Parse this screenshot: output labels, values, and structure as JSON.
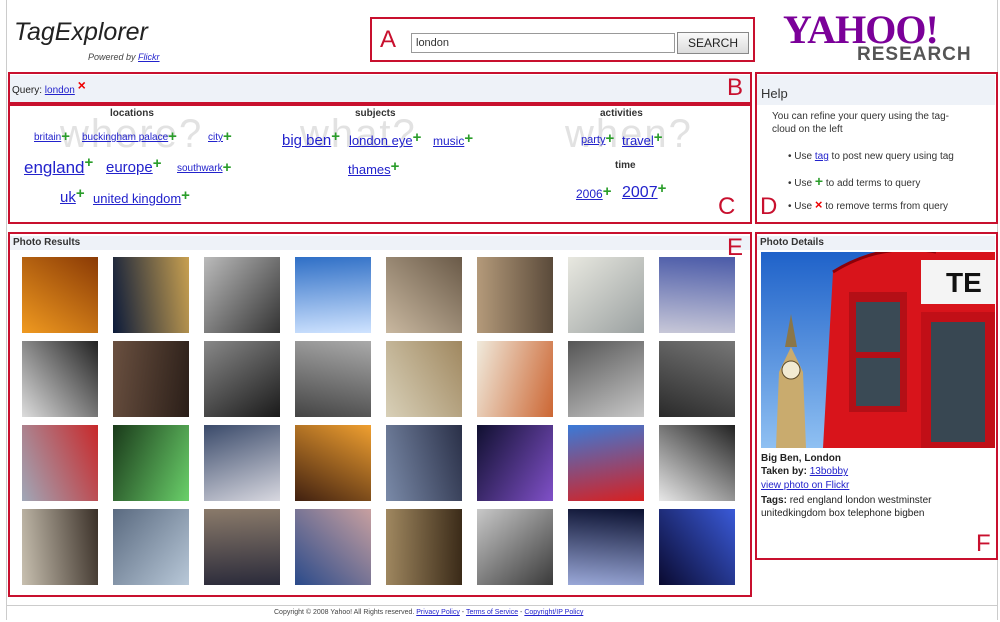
{
  "header": {
    "app_title": "TagExplorer",
    "powered_by": "Powered by",
    "powered_link": "Flickr",
    "logo_top": "YAHOO!",
    "logo_bottom": "RESEARCH"
  },
  "search": {
    "value": "london",
    "button_label": "SEARCH"
  },
  "query": {
    "label": "Query:",
    "term": "london",
    "remove_glyph": "×"
  },
  "box_labels": {
    "a": "A",
    "b": "B",
    "c": "C",
    "d": "D",
    "e": "E",
    "f": "F"
  },
  "tagcloud": {
    "ghost_words": [
      "where?",
      "what?",
      "when?"
    ],
    "locations": {
      "heading": "locations",
      "tags": [
        "britain",
        "buckingham palace",
        "city",
        "england",
        "europe",
        "southwark",
        "uk",
        "united kingdom"
      ]
    },
    "subjects": {
      "heading": "subjects",
      "tags": [
        "big ben",
        "london eye",
        "music",
        "thames"
      ]
    },
    "activities": {
      "heading": "activities",
      "tags": [
        "party",
        "travel"
      ]
    },
    "time": {
      "heading": "time",
      "tags": [
        "2006",
        "2007"
      ]
    },
    "plus_glyph": "+"
  },
  "help": {
    "title": "Help",
    "intro": "You can refine your query using the tag-cloud on the left",
    "items": [
      {
        "pre": "Use",
        "link": "tag",
        "post": "to post new query using tag"
      },
      {
        "pre": "Use",
        "glyph": "+",
        "post": "to add terms to query"
      },
      {
        "pre": "Use",
        "glyph": "×",
        "post": "to remove terms from query"
      }
    ]
  },
  "photo_results": {
    "title": "Photo Results",
    "count": 32
  },
  "photo_details": {
    "title": "Photo Details",
    "caption": "Big Ben, London",
    "taken_by_label": "Taken by:",
    "taken_by_user": "13bobby",
    "view_link": "view photo on Flickr",
    "tags_label": "Tags:",
    "tags_text": "red england london westminster unitedkingdom box telephone bigben"
  },
  "footer": {
    "copyright": "Copyright © 2008 Yahoo! All Rights reserved.",
    "privacy": "Privacy Policy",
    "terms": "Terms of Service",
    "ip": "Copyright/IP Policy",
    "sep": "-"
  },
  "colors": {
    "annotation_red": "#c8102e",
    "link_blue": "#2222cc",
    "plus_green": "#2a9d2a",
    "yahoo_purple": "#7b0099"
  }
}
